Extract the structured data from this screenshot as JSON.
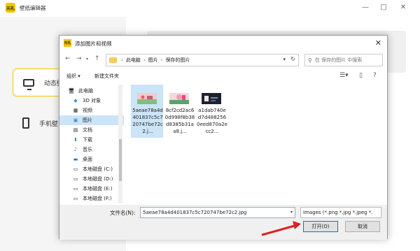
{
  "app": {
    "logo_text": "元礼",
    "title": "壁纸编辑器",
    "sidebar": [
      {
        "label": "动态壁",
        "icon": "monitor-icon",
        "active": true
      },
      {
        "label": "手机壁",
        "icon": "phone-icon",
        "active": false
      }
    ]
  },
  "dialog": {
    "logo_text": "元礼",
    "title": "添加图片和视频",
    "breadcrumb": [
      "此电脑",
      "图片",
      "保存的图片"
    ],
    "search_placeholder": "在 保存的图片 中搜索",
    "toolbar": {
      "organize": "组织 ▾",
      "new_folder": "新建文件夹"
    },
    "nav_items": [
      {
        "label": "此电脑",
        "icon": "computer-icon",
        "selected": false
      },
      {
        "label": "3D 对象",
        "icon": "cube-icon",
        "selected": false
      },
      {
        "label": "视频",
        "icon": "video-icon",
        "selected": false
      },
      {
        "label": "图片",
        "icon": "picture-icon",
        "selected": true
      },
      {
        "label": "文档",
        "icon": "document-icon",
        "selected": false
      },
      {
        "label": "下载",
        "icon": "download-icon",
        "selected": false
      },
      {
        "label": "音乐",
        "icon": "music-icon",
        "selected": false
      },
      {
        "label": "桌面",
        "icon": "desktop-icon",
        "selected": false
      },
      {
        "label": "本地磁盘 (C:)",
        "icon": "drive-icon",
        "selected": false
      },
      {
        "label": "本地磁盘 (D:)",
        "icon": "drive-icon",
        "selected": false
      },
      {
        "label": "本地磁盘 (E:)",
        "icon": "drive-icon",
        "selected": false
      },
      {
        "label": "本地磁盘 (F:)",
        "icon": "drive-icon",
        "selected": false
      }
    ],
    "files": [
      {
        "name": "5aeae78a4d401837c5c720747be72c2.j...",
        "selected": true,
        "thumb": "pink-landscape"
      },
      {
        "name": "8cf2cd2ac60d998f8b38d8385b31aa8.j...",
        "selected": false,
        "thumb": "pink-sunset"
      },
      {
        "name": "a1dab740ed7d4882560eed870a2ecc2...",
        "selected": false,
        "thumb": "dark-game"
      }
    ],
    "filename_label": "文件名(N):",
    "filename_value": "5aeae78a4d401837c5c720747be72c2.jpg",
    "filter_value": "Images (*.png *.jpg *.jpeg *.",
    "open_button": "打开(O)",
    "cancel_button": "取消"
  },
  "colors": {
    "accent": "#f6c400",
    "selection": "#cce4f7",
    "arrow": "#e02020"
  }
}
